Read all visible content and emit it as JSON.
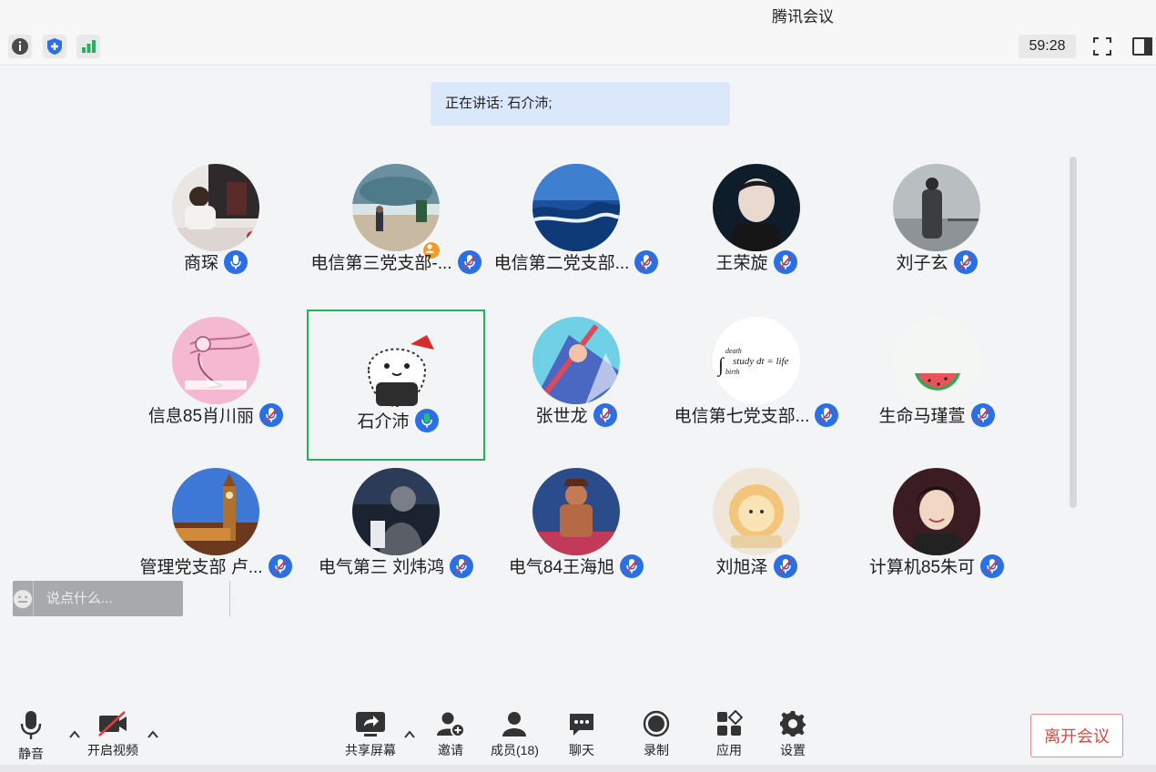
{
  "title": "腾讯会议",
  "infobar": {
    "timer": "59:28",
    "icons": [
      "info-icon",
      "shield-icon",
      "signal-icon",
      "fullscreen-icon",
      "sidebar-toggle-icon"
    ]
  },
  "speaking_banner": "正在讲话: 石介沛;",
  "participants": [
    {
      "name": "商琛",
      "mic": "blue"
    },
    {
      "name": "电信第三党支部-...",
      "mic": "muted"
    },
    {
      "name": "电信第二党支部...",
      "mic": "muted"
    },
    {
      "name": "王荣旋",
      "mic": "muted"
    },
    {
      "name": "刘子玄",
      "mic": "muted"
    },
    {
      "name": "信息85肖川丽",
      "mic": "muted"
    },
    {
      "name": "石介沛",
      "mic": "speaking"
    },
    {
      "name": "张世龙",
      "mic": "muted"
    },
    {
      "name": "电信第七党支部...",
      "mic": "muted"
    },
    {
      "name": "生命马瑾萱",
      "mic": "muted"
    },
    {
      "name": "管理党支部 卢...",
      "mic": "muted"
    },
    {
      "name": "电气第三 刘炜鸿",
      "mic": "muted"
    },
    {
      "name": "电气84王海旭",
      "mic": "muted"
    },
    {
      "name": "刘旭泽",
      "mic": "muted"
    },
    {
      "name": "计算机85朱可",
      "mic": "muted"
    }
  ],
  "avatar_art": {
    "p8_formula_top": "death",
    "p8_formula_mid": "study dt = life",
    "p8_formula_bottom": "birth"
  },
  "chat": {
    "placeholder": "说点什么..."
  },
  "toolbar": {
    "mute": "静音",
    "video": "开启视频",
    "share": "共享屏幕",
    "invite": "邀请",
    "members": "成员(18)",
    "chat": "聊天",
    "record": "录制",
    "apps": "应用",
    "settings": "设置",
    "leave": "离开会议"
  },
  "colors": {
    "accent": "#2b6fe6",
    "active_border": "#20b45a",
    "leave_text": "#e5433f",
    "banner_bg": "#dbe7fa"
  }
}
